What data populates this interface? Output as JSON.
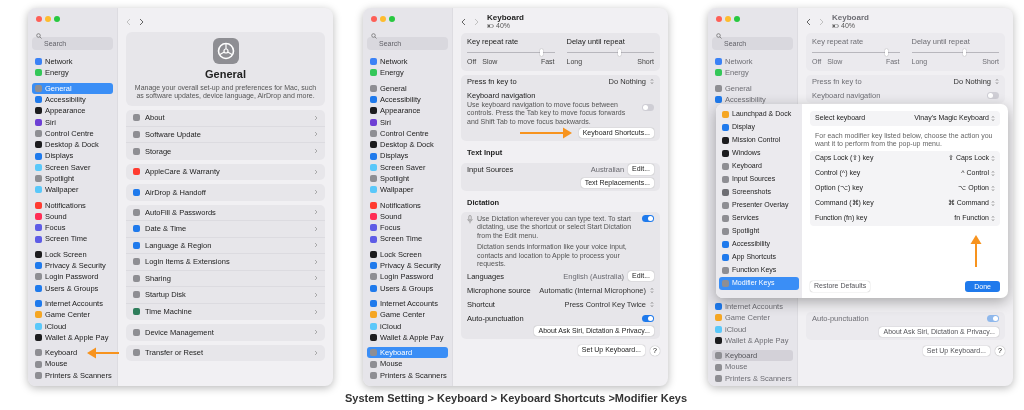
{
  "windows": [
    {
      "kind": "general",
      "dimmed": false,
      "annotations": [
        {
          "kind": "left-arrow"
        }
      ],
      "search_placeholder": "Search",
      "sidebar": [
        {
          "items": [
            {
              "label": "Network",
              "color": "#3b82f6",
              "selected": false
            },
            {
              "label": "Energy",
              "color": "#34c759",
              "selected": false
            }
          ]
        },
        {
          "items": [
            {
              "label": "General",
              "color": "#8e8e93",
              "selected": true
            },
            {
              "label": "Accessibility",
              "color": "#1f7aec",
              "selected": false
            },
            {
              "label": "Appearance",
              "color": "#1c1c1e",
              "selected": false
            },
            {
              "label": "Siri",
              "color": "#6d3fd4",
              "selected": false
            },
            {
              "label": "Control Centre",
              "color": "#8e8e93",
              "selected": false
            },
            {
              "label": "Desktop & Dock",
              "color": "#1c1c1e",
              "selected": false
            },
            {
              "label": "Displays",
              "color": "#1f7aec",
              "selected": false
            },
            {
              "label": "Screen Saver",
              "color": "#5ac8fa",
              "selected": false
            },
            {
              "label": "Spotlight",
              "color": "#8e8e93",
              "selected": false
            },
            {
              "label": "Wallpaper",
              "color": "#5ac8fa",
              "selected": false
            }
          ]
        },
        {
          "items": [
            {
              "label": "Notifications",
              "color": "#ff3b30",
              "selected": false
            },
            {
              "label": "Sound",
              "color": "#ff2d55",
              "selected": false
            },
            {
              "label": "Focus",
              "color": "#5e5ce6",
              "selected": false
            },
            {
              "label": "Screen Time",
              "color": "#5e5ce6",
              "selected": false
            }
          ]
        },
        {
          "items": [
            {
              "label": "Lock Screen",
              "color": "#1c1c1e",
              "selected": false
            },
            {
              "label": "Privacy & Security",
              "color": "#1f7aec",
              "selected": false
            },
            {
              "label": "Login Password",
              "color": "#8e8e93",
              "selected": false
            },
            {
              "label": "Users & Groups",
              "color": "#1f7aec",
              "selected": false
            }
          ]
        },
        {
          "items": [
            {
              "label": "Internet Accounts",
              "color": "#1f7aec",
              "selected": false
            },
            {
              "label": "Game Center",
              "color": "#f5a623",
              "selected": false
            },
            {
              "label": "iCloud",
              "color": "#5ac8fa",
              "selected": false
            },
            {
              "label": "Wallet & Apple Pay",
              "color": "#1c1c1e",
              "selected": false
            }
          ]
        },
        {
          "items": [
            {
              "label": "Keyboard",
              "color": "#8e8e93",
              "selected": false
            },
            {
              "label": "Mouse",
              "color": "#8e8e93",
              "selected": false
            },
            {
              "label": "Printers & Scanners",
              "color": "#8e8e93",
              "selected": false
            }
          ]
        }
      ],
      "content": {
        "header": {
          "title": "General",
          "description": "Manage your overall set-up and preferences for Mac, such as software updates, device language, AirDrop and more."
        },
        "groups": [
          [
            {
              "label": "About",
              "color": "#8e8e93"
            },
            {
              "label": "Software Update",
              "color": "#8e8e93"
            },
            {
              "label": "Storage",
              "color": "#8e8e93"
            }
          ],
          [
            {
              "label": "AppleCare & Warranty",
              "color": "#ff3b30"
            }
          ],
          [
            {
              "label": "AirDrop & Handoff",
              "color": "#1f7aec"
            }
          ],
          [
            {
              "label": "AutoFill & Passwords",
              "color": "#8e8e93"
            },
            {
              "label": "Date & Time",
              "color": "#1f7aec"
            },
            {
              "label": "Language & Region",
              "color": "#1f7aec"
            },
            {
              "label": "Login Items & Extensions",
              "color": "#8e8e93"
            },
            {
              "label": "Sharing",
              "color": "#8e8e93"
            },
            {
              "label": "Startup Disk",
              "color": "#8e8e93"
            },
            {
              "label": "Time Machine",
              "color": "#2e7d5b"
            }
          ],
          [
            {
              "label": "Device Management",
              "color": "#8e8e93"
            }
          ],
          [
            {
              "label": "Transfer or Reset",
              "color": "#8e8e93"
            }
          ]
        ]
      }
    },
    {
      "kind": "keyboard",
      "dimmed": false,
      "annotations": [
        {
          "kind": "right-arrow"
        }
      ],
      "search_placeholder": "Search",
      "sidebar": [
        {
          "items": [
            {
              "label": "Network",
              "color": "#3b82f6",
              "selected": false
            },
            {
              "label": "Energy",
              "color": "#34c759",
              "selected": false
            }
          ]
        },
        {
          "items": [
            {
              "label": "General",
              "color": "#8e8e93",
              "selected": false
            },
            {
              "label": "Accessibility",
              "color": "#1f7aec",
              "selected": false
            },
            {
              "label": "Appearance",
              "color": "#1c1c1e",
              "selected": false
            },
            {
              "label": "Siri",
              "color": "#6d3fd4",
              "selected": false
            },
            {
              "label": "Control Centre",
              "color": "#8e8e93",
              "selected": false
            },
            {
              "label": "Desktop & Dock",
              "color": "#1c1c1e",
              "selected": false
            },
            {
              "label": "Displays",
              "color": "#1f7aec",
              "selected": false
            },
            {
              "label": "Screen Saver",
              "color": "#5ac8fa",
              "selected": false
            },
            {
              "label": "Spotlight",
              "color": "#8e8e93",
              "selected": false
            },
            {
              "label": "Wallpaper",
              "color": "#5ac8fa",
              "selected": false
            }
          ]
        },
        {
          "items": [
            {
              "label": "Notifications",
              "color": "#ff3b30",
              "selected": false
            },
            {
              "label": "Sound",
              "color": "#ff2d55",
              "selected": false
            },
            {
              "label": "Focus",
              "color": "#5e5ce6",
              "selected": false
            },
            {
              "label": "Screen Time",
              "color": "#5e5ce6",
              "selected": false
            }
          ]
        },
        {
          "items": [
            {
              "label": "Lock Screen",
              "color": "#1c1c1e",
              "selected": false
            },
            {
              "label": "Privacy & Security",
              "color": "#1f7aec",
              "selected": false
            },
            {
              "label": "Login Password",
              "color": "#8e8e93",
              "selected": false
            },
            {
              "label": "Users & Groups",
              "color": "#1f7aec",
              "selected": false
            }
          ]
        },
        {
          "items": [
            {
              "label": "Internet Accounts",
              "color": "#1f7aec",
              "selected": false
            },
            {
              "label": "Game Center",
              "color": "#f5a623",
              "selected": false
            },
            {
              "label": "iCloud",
              "color": "#5ac8fa",
              "selected": false
            },
            {
              "label": "Wallet & Apple Pay",
              "color": "#1c1c1e",
              "selected": false
            }
          ]
        },
        {
          "items": [
            {
              "label": "Keyboard",
              "color": "#8e8e93",
              "selected": true
            },
            {
              "label": "Mouse",
              "color": "#8e8e93",
              "selected": false
            },
            {
              "label": "Printers & Scanners",
              "color": "#8e8e93",
              "selected": false
            }
          ]
        }
      ],
      "content": {
        "title": "Keyboard",
        "battery": "40%",
        "sections": [
          {
            "kind": "sliders",
            "sliders": [
              {
                "label": "Key repeat rate",
                "level": 0.85,
                "marks": [
                  "Off",
                  "Slow",
                  "Fast"
                ]
              },
              {
                "label": "Delay until repeat",
                "level": 0.6,
                "marks": [
                  "Long",
                  "Short"
                ]
              }
            ]
          },
          {
            "kind": "card",
            "rows": [
              {
                "kind": "popup",
                "label": "Press fn key to",
                "value": "Do Nothing"
              },
              {
                "kind": "toggle",
                "label": "Keyboard navigation",
                "description": "Use keyboard navigation to move focus between controls. Press the Tab key to move focus forwards and Shift Tab to move focus backwards.",
                "on": false
              },
              {
                "kind": "button",
                "label": "Keyboard Shortcuts..."
              }
            ]
          },
          {
            "kind": "heading",
            "text": "Text Input"
          },
          {
            "kind": "card",
            "rows": [
              {
                "kind": "edit",
                "label": "Input Sources",
                "value": "Australian",
                "button": "Edit..."
              },
              {
                "kind": "button",
                "label": "Text Replacements..."
              }
            ]
          },
          {
            "kind": "heading",
            "text": "Dictation"
          },
          {
            "kind": "card",
            "rows": [
              {
                "kind": "dictation",
                "text": "Use Dictation wherever you can type text. To start dictating, use the shortcut or select Start Dictation from the Edit menu.",
                "note": "Dictation sends information like your voice input, contacts and location to Apple to process your requests.",
                "on": true
              },
              {
                "kind": "edit",
                "label": "Languages",
                "value": "English (Australia)",
                "button": "Edit..."
              },
              {
                "kind": "popup",
                "label": "Microphone source",
                "value": "Automatic (Internal Microphone)"
              },
              {
                "kind": "popup",
                "label": "Shortcut",
                "value": "Press Control Key Twice"
              },
              {
                "kind": "toggle",
                "label": "Auto-punctuation",
                "on": true
              },
              {
                "kind": "button",
                "label": "About Ask Siri, Dictation & Privacy..."
              }
            ]
          },
          {
            "kind": "footer",
            "button": "Set Up Keyboard...",
            "help": "?"
          }
        ]
      }
    },
    {
      "kind": "keyboard",
      "dimmed": true,
      "annotations": [
        {
          "kind": "up-arrow"
        }
      ],
      "search_placeholder": "Search",
      "sidebar": [
        {
          "items": [
            {
              "label": "Network",
              "color": "#3b82f6",
              "selected": false
            },
            {
              "label": "Energy",
              "color": "#34c759",
              "selected": false
            }
          ]
        },
        {
          "items": [
            {
              "label": "General",
              "color": "#8e8e93",
              "selected": false
            },
            {
              "label": "Accessibility",
              "color": "#1f7aec",
              "selected": false
            }
          ]
        },
        {
          "push": true,
          "items": [
            {
              "label": "Internet Accounts",
              "color": "#1f7aec",
              "selected": false
            },
            {
              "label": "Game Center",
              "color": "#f5a623",
              "selected": false
            },
            {
              "label": "iCloud",
              "color": "#5ac8fa",
              "selected": false
            },
            {
              "label": "Wallet & Apple Pay",
              "color": "#1c1c1e",
              "selected": false
            }
          ]
        },
        {
          "items": [
            {
              "label": "Keyboard",
              "color": "#8e8e93",
              "selected": true
            },
            {
              "label": "Mouse",
              "color": "#8e8e93",
              "selected": false
            },
            {
              "label": "Printers & Scanners",
              "color": "#8e8e93",
              "selected": false
            }
          ]
        }
      ],
      "content": {
        "title": "Keyboard",
        "battery": "40%",
        "sections": [
          {
            "kind": "sliders",
            "sliders": [
              {
                "label": "Key repeat rate",
                "level": 0.85,
                "marks": [
                  "Off",
                  "Slow",
                  "Fast"
                ]
              },
              {
                "label": "Delay until repeat",
                "level": 0.6,
                "marks": [
                  "Long",
                  "Short"
                ]
              }
            ]
          },
          {
            "kind": "card",
            "rows": [
              {
                "kind": "popup",
                "label": "Press fn key to",
                "value": "Do Nothing"
              },
              {
                "kind": "toggle",
                "label": "Keyboard navigation",
                "on": false
              }
            ]
          },
          {
            "kind": "card",
            "push": true,
            "rows": [
              {
                "kind": "toggle",
                "label": "Auto-punctuation",
                "on": true
              },
              {
                "kind": "button",
                "label": "About Ask Siri, Dictation & Privacy..."
              }
            ]
          },
          {
            "kind": "footer",
            "button": "Set Up Keyboard...",
            "help": "?"
          }
        ]
      },
      "dialog": {
        "sidebar": [
          {
            "label": "Launchpad & Dock",
            "color": "#f5a623",
            "selected": false
          },
          {
            "label": "Display",
            "color": "#1f7aec",
            "selected": false
          },
          {
            "label": "Mission Control",
            "color": "#1c1c1e",
            "selected": false
          },
          {
            "label": "Windows",
            "color": "#1c1c1e",
            "selected": false
          },
          {
            "label": "Keyboard",
            "color": "#8e8e93",
            "selected": false
          },
          {
            "label": "Input Sources",
            "color": "#8e8e93",
            "selected": false
          },
          {
            "label": "Screenshots",
            "color": "#6e6e73",
            "selected": false
          },
          {
            "label": "Presenter Overlay",
            "color": "#8e8e93",
            "selected": false
          },
          {
            "label": "Services",
            "color": "#8e8e93",
            "selected": false
          },
          {
            "label": "Spotlight",
            "color": "#8e8e93",
            "selected": false
          },
          {
            "label": "Accessibility",
            "color": "#1f7aec",
            "selected": false
          },
          {
            "label": "App Shortcuts",
            "color": "#1f7aec",
            "selected": false
          },
          {
            "label": "Function Keys",
            "color": "#8e8e93",
            "selected": false
          },
          {
            "label": "Modifier Keys",
            "color": "#8e8e93",
            "selected": true
          }
        ],
        "select": {
          "label": "Select keyboard",
          "value": "Vinay's Magic Keyboard"
        },
        "description": "For each modifier key listed below, choose the action you want it to perform from the pop-up menu.",
        "rows": [
          {
            "label": "Caps Lock (⇪) key",
            "value": "⇪ Caps Lock"
          },
          {
            "label": "Control (^) key",
            "value": "^ Control"
          },
          {
            "label": "Option (⌥) key",
            "value": "⌥ Option"
          },
          {
            "label": "Command (⌘) key",
            "value": "⌘ Command"
          },
          {
            "label": "Function (fn) key",
            "value": "fn Function"
          }
        ],
        "buttons": [
          {
            "label": "Restore Defaults",
            "kind": "default"
          },
          {
            "label": "Done",
            "kind": "primary"
          }
        ]
      }
    }
  ],
  "caption": "System Setting > Keyboard > Keyboard Shortcuts >Modifier Keys"
}
